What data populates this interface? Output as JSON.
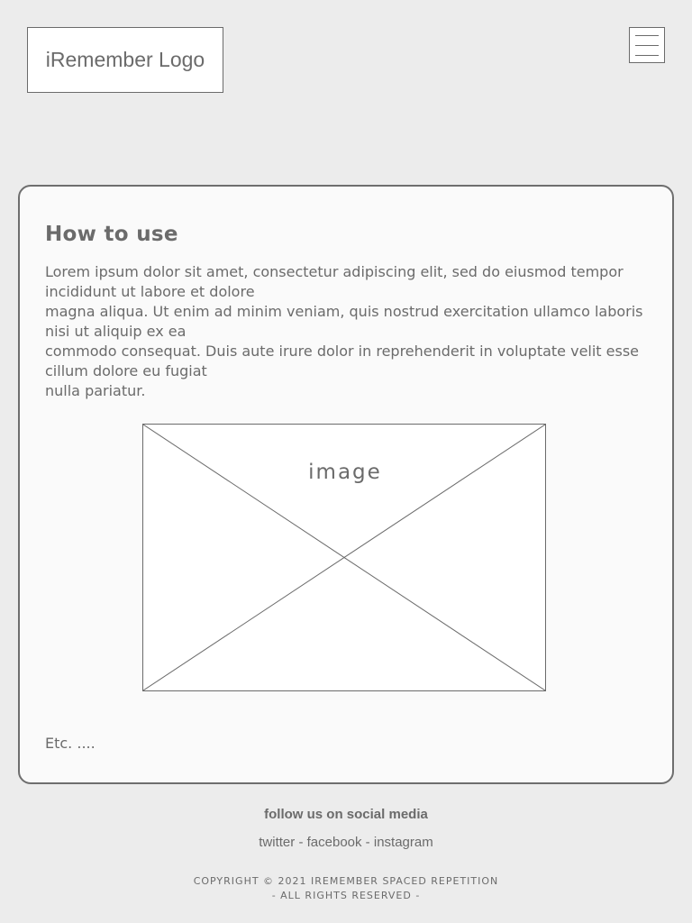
{
  "header": {
    "logo_text": "iRemember Logo",
    "menu_icon": "hamburger-menu-icon"
  },
  "card": {
    "title": "How to use",
    "paragraphs": [
      "Lorem ipsum dolor sit amet, consectetur adipiscing elit, sed do eiusmod tempor incididunt ut labore et dolore",
      "magna aliqua. Ut enim ad minim veniam, quis nostrud exercitation ullamco laboris nisi ut aliquip ex ea",
      "commodo consequat. Duis aute irure dolor in reprehenderit in voluptate velit esse cillum dolore eu fugiat",
      "nulla pariatur."
    ],
    "image_label": "image",
    "etc": "Etc. ...."
  },
  "footer": {
    "follow_title": "follow us on social media",
    "links": [
      "twitter",
      "facebook",
      "instagram"
    ],
    "separator": " - ",
    "copyright_line1": "COPYRIGHT © 2021 IREMEMBER SPACED REPETITION",
    "copyright_line2": "- ALL RIGHTS RESERVED -"
  },
  "colors": {
    "page_background": "#ececec",
    "text": "#6b6b6b",
    "card_border": "#6e6e6e",
    "card_background": "#fafafa"
  }
}
